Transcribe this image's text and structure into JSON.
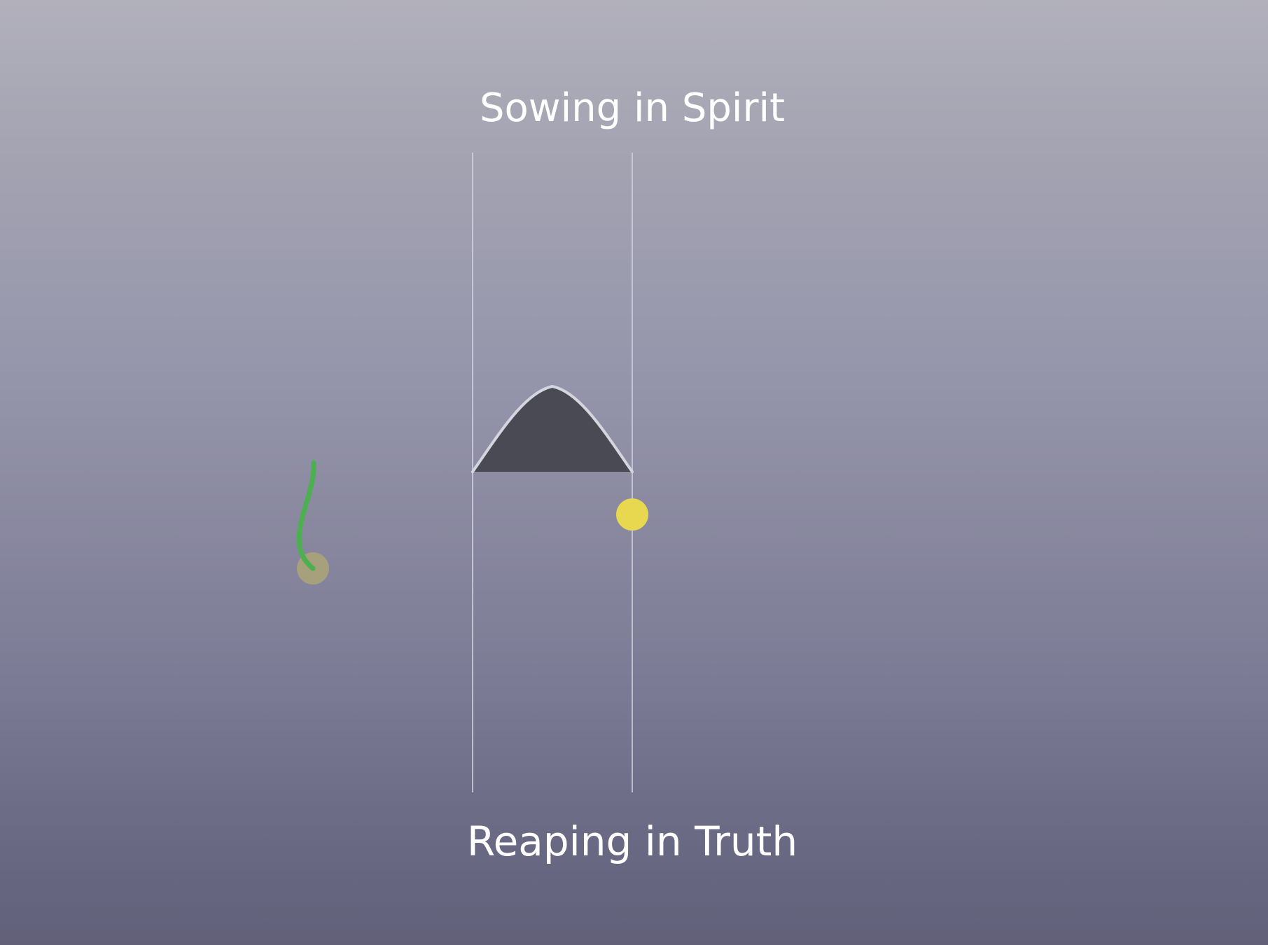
{
  "scene": {
    "top_text": "Sowing in Spirit",
    "bottom_text": "Reaping in Truth"
  },
  "palette": {
    "background_top": "#b1b0bb",
    "background_bottom": "#626079",
    "guide_line": "#c6c6d6",
    "mound_fill": "#4a4a55",
    "mound_outline": "#d5d5df",
    "sprout": "#4caf50",
    "seed": "#a6a17c",
    "sun": "#e8d84f"
  }
}
